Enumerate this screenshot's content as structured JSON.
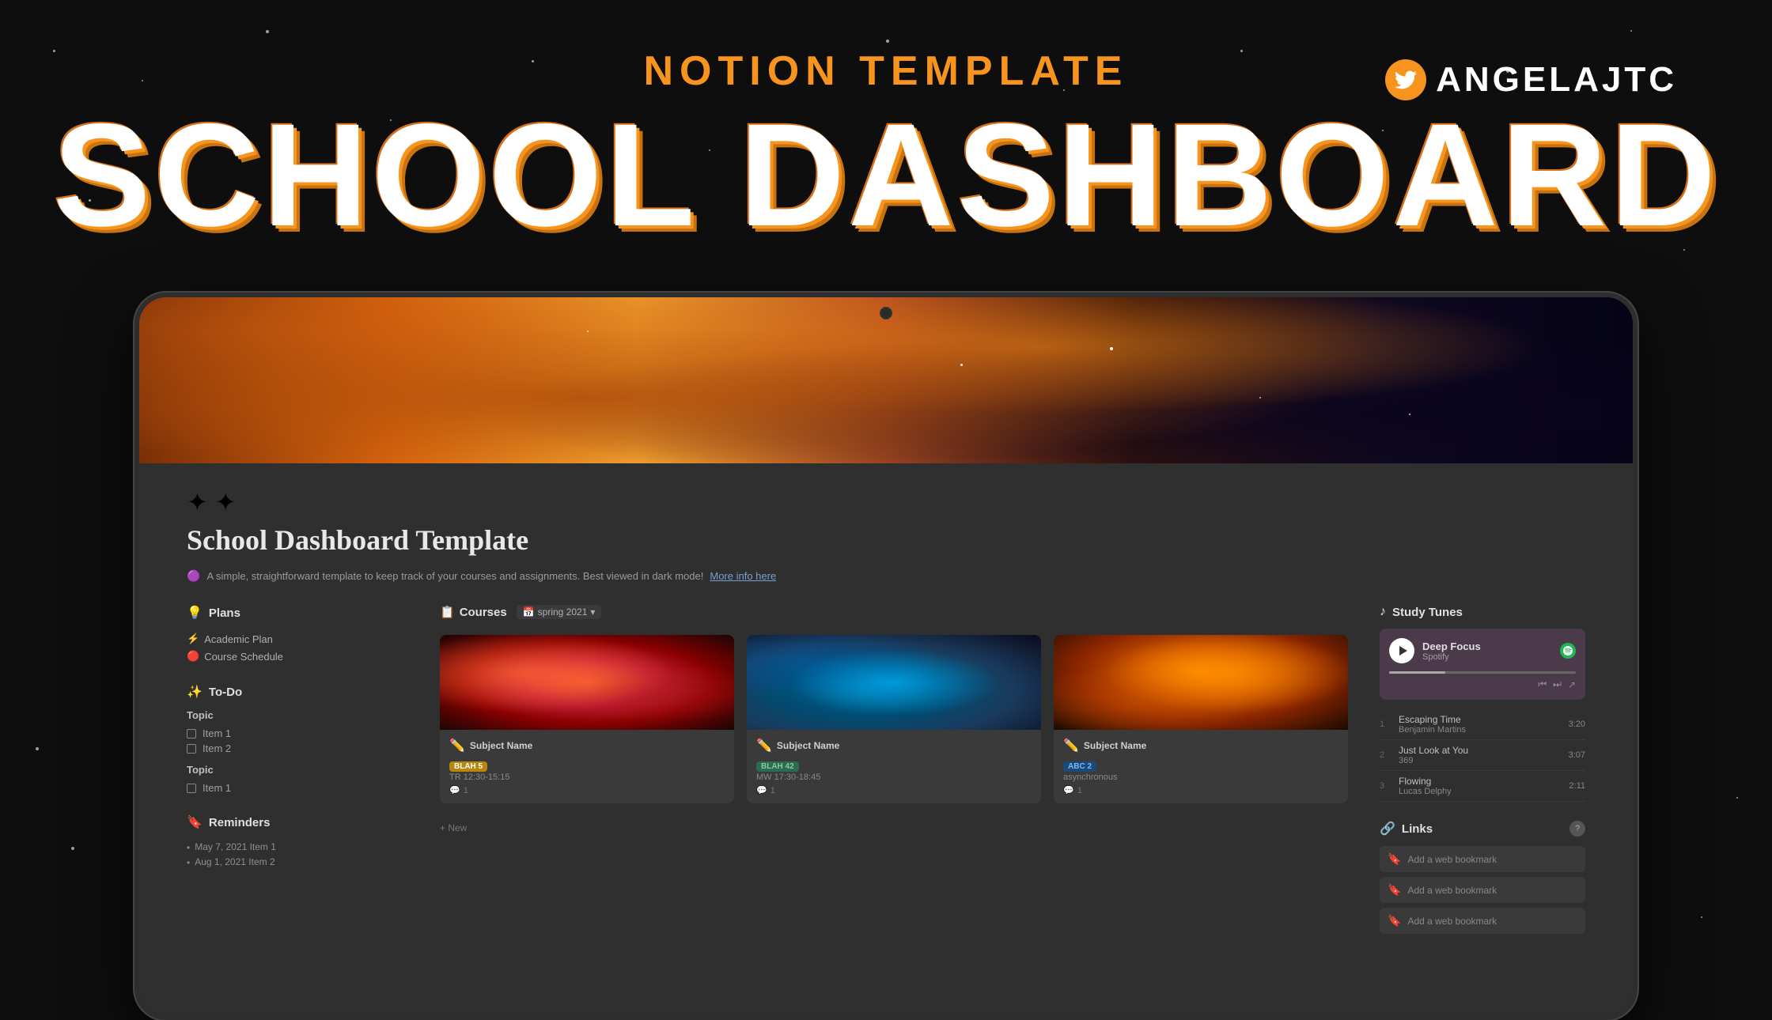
{
  "page": {
    "background_color": "#0e0e0e"
  },
  "header": {
    "subtitle": "NOTION TEMPLATE",
    "title": "SCHOOL DASHBOARD",
    "social": {
      "handle": "ANGELAJTC",
      "platform": "Twitter"
    }
  },
  "notion": {
    "banner_alt": "Space nebula banner",
    "sparkles": "✦✦",
    "page_title": "School Dashboard Template",
    "description": "A simple, straightforward template to keep track of your courses and assignments. Best viewed in dark mode!",
    "description_link": "More info here",
    "sections": {
      "plans": {
        "heading": "Plans",
        "icon": "💡",
        "items": [
          {
            "label": "Academic Plan",
            "icon": "⚡"
          },
          {
            "label": "Course Schedule",
            "icon": "🔴"
          }
        ]
      },
      "todo": {
        "heading": "To-Do",
        "icon": "✨",
        "groups": [
          {
            "topic": "Topic",
            "items": [
              "Item 1",
              "Item 2"
            ]
          },
          {
            "topic": "Topic",
            "items": [
              "Item 1"
            ]
          }
        ]
      },
      "reminders": {
        "heading": "Reminders",
        "icon": "🔖",
        "items": [
          {
            "date": "May 7, 2021",
            "label": "Item 1"
          },
          {
            "date": "Aug 1, 2021",
            "label": "Item 2"
          }
        ]
      }
    },
    "courses": {
      "heading": "Courses",
      "icon": "📋",
      "filter": "spring 2021",
      "cards": [
        {
          "name": "Subject Name",
          "tag": "BLAH 5",
          "tag_class": "tag-yellow",
          "time": "TR 12:30-15:15",
          "comments": "1",
          "img_class": "course-img-1",
          "overlay_class": "nebula-overlay-1"
        },
        {
          "name": "Subject Name",
          "tag": "BLAH 42",
          "tag_class": "tag-green",
          "time": "MW 17:30-18:45",
          "comments": "1",
          "img_class": "course-img-2",
          "overlay_class": "nebula-overlay-2"
        },
        {
          "name": "Subject Name",
          "tag": "ABC 2",
          "tag_class": "tag-blue",
          "time": "asynchronous",
          "comments": "1",
          "img_class": "course-img-3",
          "overlay_class": "nebula-overlay-3"
        }
      ],
      "add_new_label": "+ New"
    },
    "study_tunes": {
      "heading": "Study Tunes",
      "icon": "♪",
      "player": {
        "title": "Deep Focus",
        "source": "Spotify",
        "playing": true
      },
      "tracks": [
        {
          "num": "1",
          "title": "Escaping Time",
          "artist": "Benjamin Martins",
          "duration": "3:20"
        },
        {
          "num": "2",
          "title": "Just Look at You",
          "artist": "369",
          "duration": "3:07"
        },
        {
          "num": "3",
          "title": "Flowing",
          "artist": "Lucas Delphy",
          "duration": "2:11"
        }
      ]
    },
    "links": {
      "heading": "Links",
      "icon": "🔗",
      "help_label": "?",
      "bookmarks": [
        {
          "label": "Add a web bookmark"
        },
        {
          "label": "Add a web bookmark"
        },
        {
          "label": "Add a web bookmark"
        }
      ]
    }
  }
}
